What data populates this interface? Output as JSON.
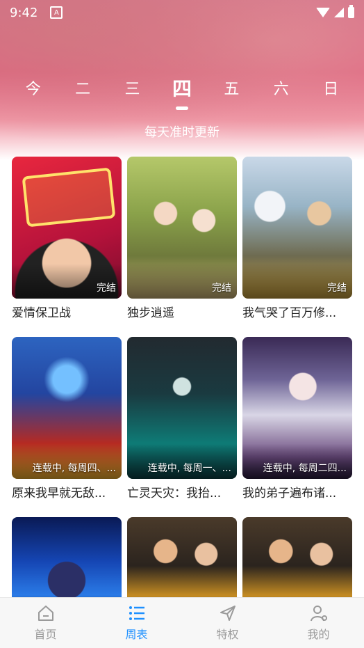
{
  "status_bar": {
    "time": "9:42",
    "notification_icon": "A"
  },
  "day_tabs": [
    {
      "label": "今"
    },
    {
      "label": "二"
    },
    {
      "label": "三"
    },
    {
      "label": "四",
      "active": true
    },
    {
      "label": "五"
    },
    {
      "label": "六"
    },
    {
      "label": "日"
    }
  ],
  "subtitle": "每天准时更新",
  "cards": [
    {
      "title": "爱情保卫战",
      "badge": "完结"
    },
    {
      "title": "独步逍遥",
      "badge": "完结"
    },
    {
      "title": "我气哭了百万修...",
      "badge": "完结"
    },
    {
      "title": "原来我早就无敌...",
      "badge": "连载中, 每周四、..."
    },
    {
      "title": "亡灵天灾：我抬...",
      "badge": "连载中, 每周一、..."
    },
    {
      "title": "我的弟子遍布诸...",
      "badge": "连载中, 每周二四..."
    },
    {
      "title": "",
      "badge": ""
    },
    {
      "title": "",
      "badge": ""
    },
    {
      "title": "",
      "badge": ""
    }
  ],
  "tab_bar": [
    {
      "label": "首页",
      "icon": "home-icon"
    },
    {
      "label": "周表",
      "icon": "list-icon",
      "active": true
    },
    {
      "label": "特权",
      "icon": "send-icon"
    },
    {
      "label": "我的",
      "icon": "user-icon"
    }
  ],
  "colors": {
    "accent": "#1e90ff",
    "tab_inactive": "#9a9a9a"
  }
}
